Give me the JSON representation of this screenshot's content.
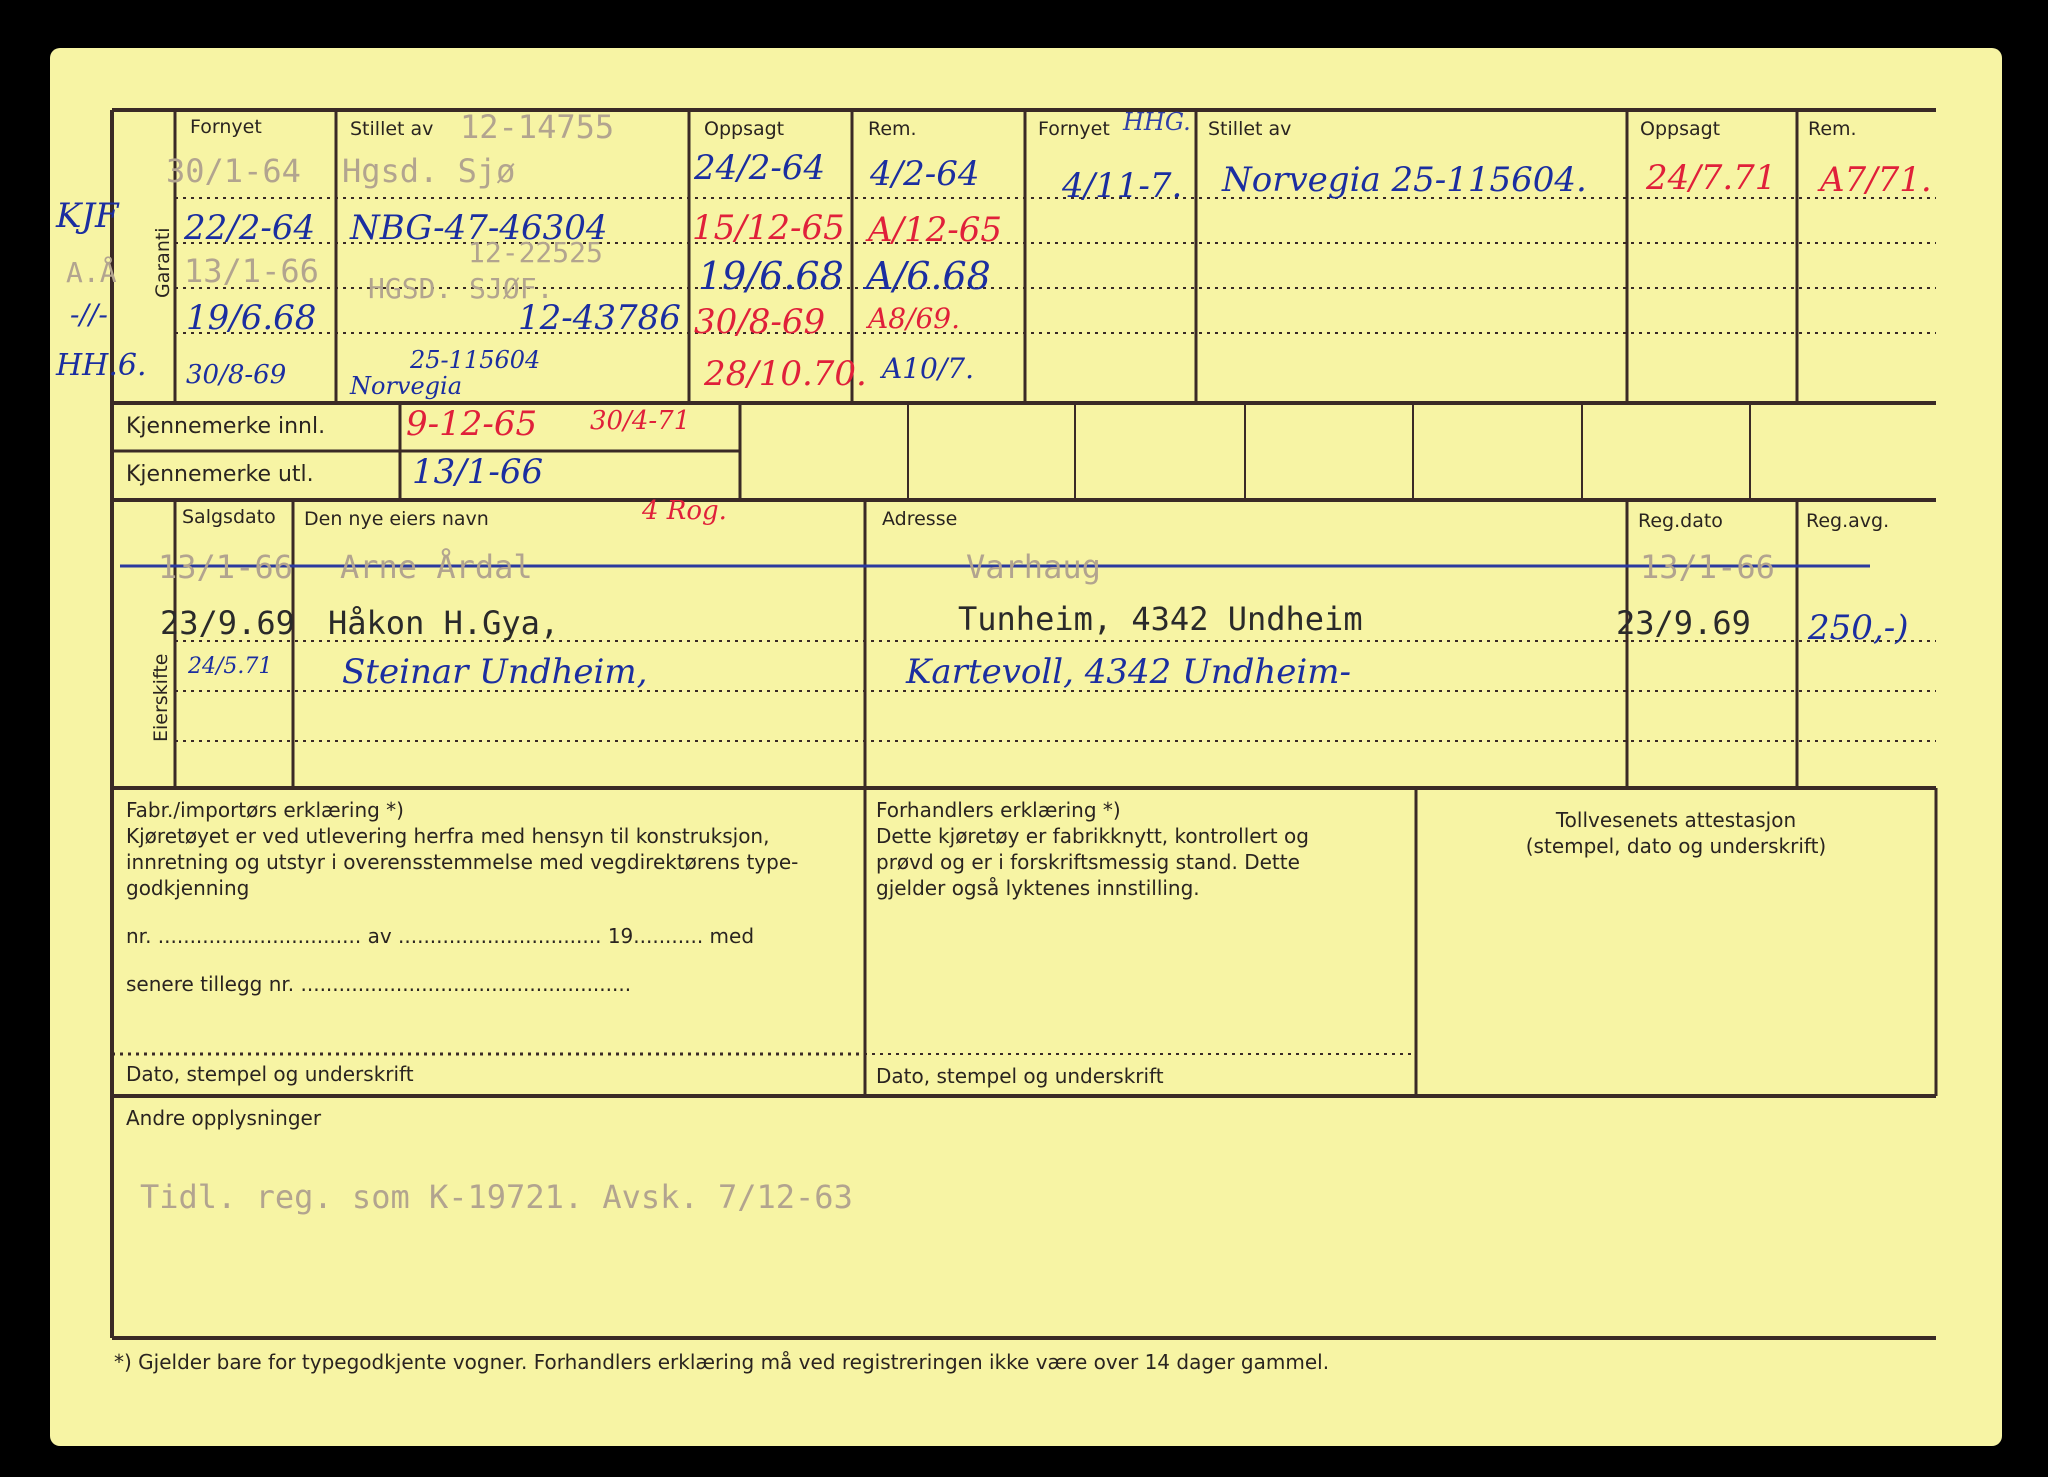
{
  "top_section": {
    "garanti_label": "Garanti",
    "headers": {
      "fornyet": "Fornyet",
      "stillet_av": "Stillet av",
      "oppsagt": "Oppsagt",
      "rem": "Rem.",
      "fornyet2": "Fornyet",
      "stillet_av2": "Stillet av",
      "oppsagt2": "Oppsagt",
      "rem2": "Rem."
    },
    "typed_stillet_av": "12-14755",
    "left_margin_notes": [
      "KJF",
      "A.Å",
      "-//-",
      "HH.6."
    ],
    "rows": [
      {
        "fornyet": "30/1-64",
        "stillet_av": "Hgsd. Sjø",
        "oppsagt": "24/2-64",
        "rem": "4/2-64"
      },
      {
        "fornyet": "22/2-64",
        "stillet_av": "NBG-47-46304",
        "oppsagt": "15/12-65",
        "rem": "A/12-65"
      },
      {
        "fornyet": "13/1-66",
        "stillet_av": "12-22525",
        "stillet_av_2": "HGSD. SJØF.",
        "oppsagt": "19/6.68",
        "rem": "A/6.68"
      },
      {
        "fornyet": "19/6.68",
        "stillet_av": "12-43786",
        "oppsagt": "30/8-69",
        "rem": "A8/69."
      },
      {
        "fornyet": "30/8-69",
        "stillet_av": "25-115604",
        "stillet_av_2": "Norvegia",
        "oppsagt": "28/10.70.",
        "rem": "A10/7."
      }
    ],
    "right_row": {
      "fornyet": "4/11-7.",
      "fornyet_header_note": "HHG.",
      "stillet_av": "Norvegia 25-115604.",
      "oppsagt": "24/7.71",
      "rem": "A7/71."
    }
  },
  "kjennemerke": {
    "innl_label": "Kjennemerke innl.",
    "utl_label": "Kjennemerke utl.",
    "innl_value": "9-12-65",
    "innl_value_2": "30/4-71",
    "utl_value": "13/1-66"
  },
  "eierskifte": {
    "label": "Eierskifte",
    "headers": {
      "salgsdato": "Salgsdato",
      "nye_eier": "Den nye eiers navn",
      "nye_eier_note": "4 Rog.",
      "adresse": "Adresse",
      "regdato": "Reg.dato",
      "regavg": "Reg.avg."
    },
    "rows": [
      {
        "salgsdato": "13/1-66",
        "navn": "Arne Årdal",
        "adresse": "Varhaug",
        "regdato": "13/1-66",
        "regavg": ""
      },
      {
        "salgsdato": "23/9.69",
        "navn": "Håkon H.Gya,",
        "adresse": "Tunheim, 4342 Undheim",
        "regdato": "23/9.69",
        "regavg": "250,-)"
      },
      {
        "salgsdato": "24/5.71",
        "navn": "Steinar Undheim,",
        "adresse": "Kartevoll, 4342 Undheim-",
        "regdato": "",
        "regavg": ""
      }
    ]
  },
  "declarations": {
    "fabr_title": "Fabr./importørs erklæring *)",
    "fabr_text": [
      "Kjøretøyet er ved utlevering herfra med hensyn til konstruksjon,",
      "innretning og utstyr i overensstemmelse med vegdirektørens type-",
      "godkjenning"
    ],
    "fabr_nr_line": "nr. ................................ av ................................ 19........... med",
    "fabr_tillegg_line": "senere tillegg nr. ....................................................",
    "fabr_footer": "Dato, stempel og underskrift",
    "forh_title": "Forhandlers erklæring *)",
    "forh_text": [
      "Dette kjøretøy er fabrikknytt, kontrollert og",
      "prøvd og er i forskriftsmessig stand. Dette",
      "gjelder også lyktenes innstilling."
    ],
    "forh_footer": "Dato, stempel og underskrift",
    "toll_title": "Tollvesenets attestasjon",
    "toll_sub": "(stempel, dato og underskrift)"
  },
  "andre": {
    "label": "Andre opplysninger",
    "text": "Tidl. reg. som K-19721. Avsk. 7/12-63"
  },
  "footnote": "*)  Gjelder bare for typegodkjente vogner.  Forhandlers erklæring må ved registreringen ikke være over 14 dager gammel."
}
